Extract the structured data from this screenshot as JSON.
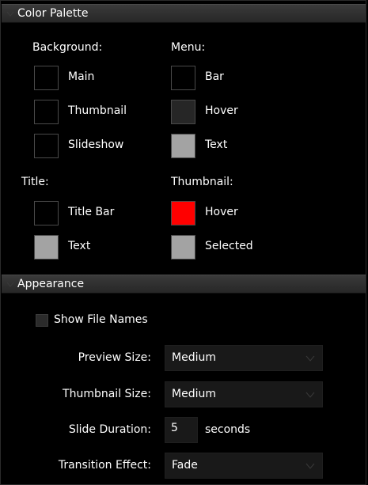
{
  "color_palette": {
    "header": "Color Palette",
    "background": {
      "heading": "Background:",
      "items": [
        {
          "label": "Main",
          "color": "#000000"
        },
        {
          "label": "Thumbnail",
          "color": "#000000"
        },
        {
          "label": "Slideshow",
          "color": "#000000"
        }
      ]
    },
    "menu": {
      "heading": "Menu:",
      "items": [
        {
          "label": "Bar",
          "color": "#000000"
        },
        {
          "label": "Hover",
          "color": "#262626"
        },
        {
          "label": "Text",
          "color": "#a3a3a3"
        }
      ]
    },
    "title": {
      "heading": "Title:",
      "items": [
        {
          "label": "Title Bar",
          "color": "#000000"
        },
        {
          "label": "Text",
          "color": "#a3a3a3"
        }
      ]
    },
    "thumbnail": {
      "heading": "Thumbnail:",
      "items": [
        {
          "label": "Hover",
          "color": "#ff0000"
        },
        {
          "label": "Selected",
          "color": "#a3a3a3"
        }
      ]
    }
  },
  "appearance": {
    "header": "Appearance",
    "show_file_names": {
      "label": "Show File Names",
      "checked": false
    },
    "preview_size": {
      "label": "Preview Size:",
      "value": "Medium"
    },
    "thumbnail_size": {
      "label": "Thumbnail Size:",
      "value": "Medium"
    },
    "slide_duration": {
      "label": "Slide Duration:",
      "value": "5",
      "unit": "seconds"
    },
    "transition_effect": {
      "label": "Transition Effect:",
      "value": "Fade"
    }
  }
}
